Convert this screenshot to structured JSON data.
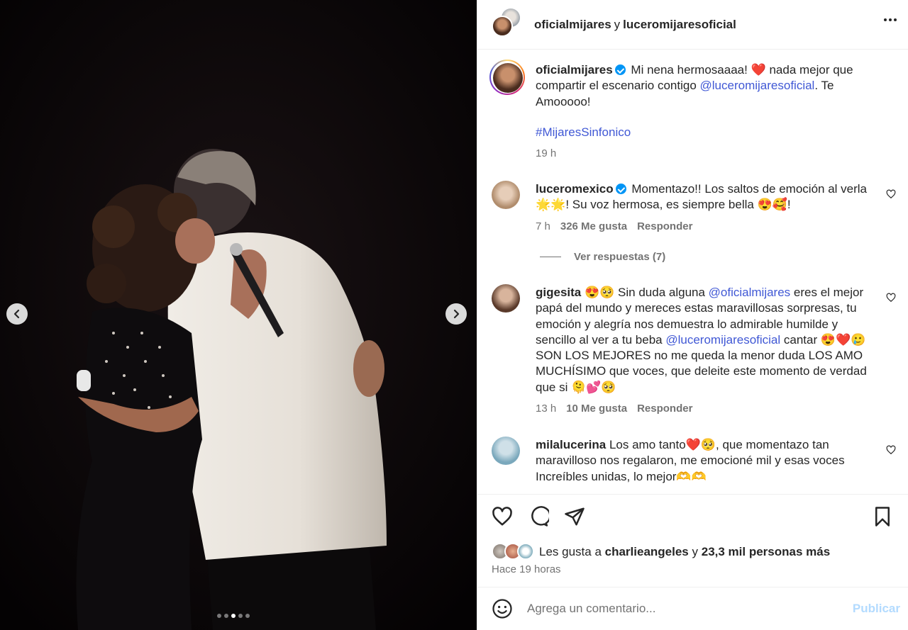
{
  "header": {
    "user1": "oficialmijares",
    "conj": "y",
    "user2": "luceromijaresoficial"
  },
  "caption": {
    "username": "oficialmijares",
    "text1": "Mi nena hermosaaaa! ❤️ nada mejor que compartir el escenario contigo ",
    "mention": "@luceromijaresoficial",
    "text2": ". Te Amooooo!",
    "hashtag": "#MijaresSinfonico",
    "time": "19 h"
  },
  "comments": [
    {
      "username": "luceromexico",
      "verified": true,
      "text": "Momentazo!! Los saltos de emoción al verla 🌟🌟! Su voz hermosa, es siempre bella 😍🥰!",
      "time": "7 h",
      "likes": "326 Me gusta",
      "reply": "Responder",
      "view_replies": "Ver respuestas (7)"
    },
    {
      "username": "gigesita",
      "text_a": "😍🥺 Sin duda alguna ",
      "mention1": "@oficialmijares",
      "text_b": " eres el mejor papá del mundo y mereces estas maravillosas sorpresas, tu emoción y alegría nos demuestra lo admirable humilde y sencillo al ver a tu beba ",
      "mention2": "@luceromijaresoficial",
      "text_c": " cantar 😍❤️🥲 SON LOS MEJORES no me queda la menor duda LOS AMO MUCHÍSIMO que voces, que deleite este momento de verdad que si 🫠💕🥺",
      "time": "13 h",
      "likes": "10 Me gusta",
      "reply": "Responder"
    },
    {
      "username": "milalucerina",
      "text": "Los amo tanto❤️🥺, que momentazo tan maravilloso nos regalaron, me emocioné mil y esas voces Increíbles unidas, lo mejor🫶🫶"
    }
  ],
  "likes": {
    "prefix": "Les gusta a",
    "user": "charlieangeles",
    "conj": "y",
    "others": "23,3 mil personas más",
    "time": "Hace 19 horas"
  },
  "add_comment": {
    "placeholder": "Agrega un comentario...",
    "post": "Publicar"
  },
  "colors": {
    "link": "#4058d5",
    "verified": "#0095f6",
    "post_disabled": "#b3dbff"
  },
  "carousel": {
    "total_slides": 5,
    "active_slide": 3
  }
}
